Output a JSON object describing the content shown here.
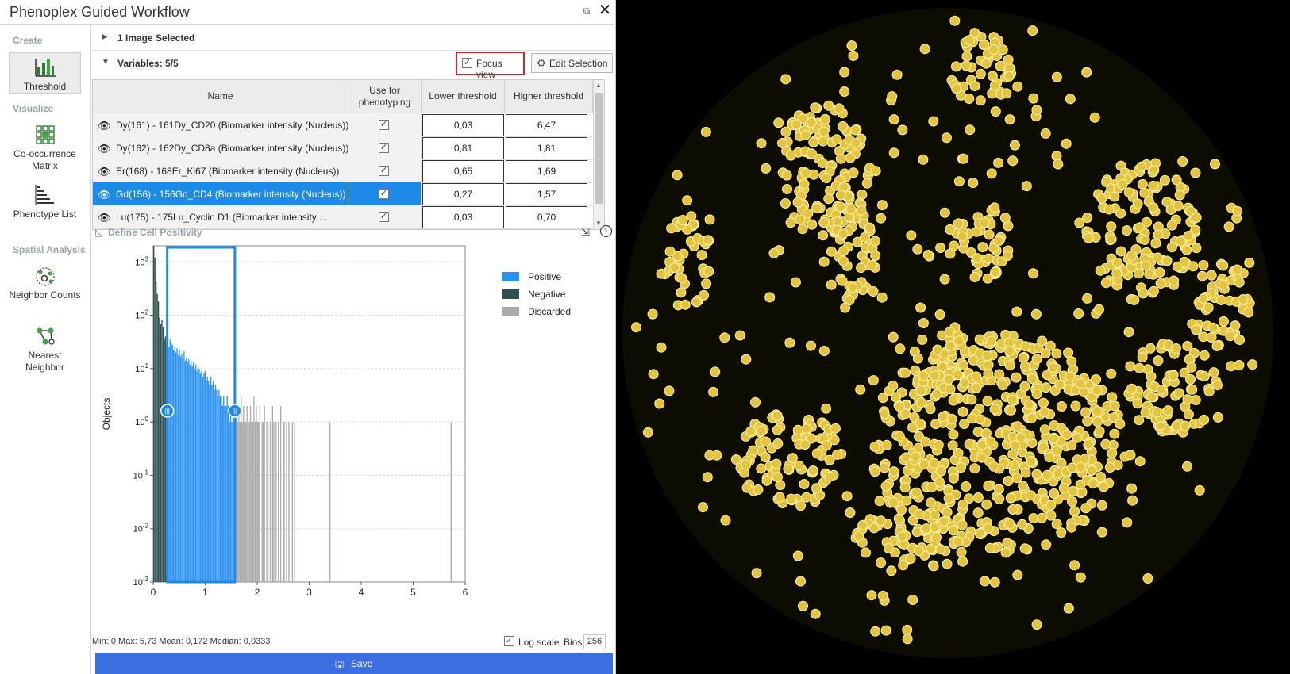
{
  "window": {
    "title": "Phenoplex Guided Workflow"
  },
  "sidebar": {
    "sections": [
      {
        "label": "Create"
      },
      {
        "label": "Visualize"
      },
      {
        "label": "Spatial Analysis"
      }
    ],
    "tools": [
      {
        "label": "Threshold",
        "icon": "threshold-icon",
        "active": true
      },
      {
        "label": "Co-occurrence Matrix",
        "icon": "cooccurrence-matrix-icon"
      },
      {
        "label": "Phenotype List",
        "icon": "phenotype-list-icon"
      },
      {
        "label": "Neighbor Counts",
        "icon": "neighbor-counts-icon"
      },
      {
        "label": "Nearest Neighbor",
        "icon": "nearest-neighbor-icon"
      }
    ]
  },
  "images_section": {
    "label": "1 Image Selected"
  },
  "variables_section": {
    "label": "Variables: 5/5",
    "focus_view_label": "Focus view",
    "focus_view_checked": true,
    "edit_selection_label": "Edit Selection"
  },
  "table": {
    "headers": {
      "name": "Name",
      "use": "Use for phenotyping",
      "lower": "Lower threshold",
      "higher": "Higher threshold"
    },
    "rows": [
      {
        "name": "Dy(161) - 161Dy_CD20 (Biomarker intensity (Nucleus))",
        "use": true,
        "lower": "0,03",
        "higher": "6,47",
        "selected": false
      },
      {
        "name": "Dy(162) - 162Dy_CD8a (Biomarker intensity (Nucleus))",
        "use": true,
        "lower": "0,81",
        "higher": "1,81",
        "selected": false
      },
      {
        "name": "Er(168) - 168Er_Ki67 (Biomarker intensity (Nucleus))",
        "use": true,
        "lower": "0,65",
        "higher": "1,69",
        "selected": false
      },
      {
        "name": "Gd(156) - 156Gd_CD4 (Biomarker intensity (Nucleus))",
        "use": true,
        "lower": "0,27",
        "higher": "1,57",
        "selected": true
      },
      {
        "name": "Lu(175) - 175Lu_Cyclin D1 (Biomarker intensity ...",
        "use": true,
        "lower": "0,03",
        "higher": "0,70",
        "selected": false
      }
    ]
  },
  "positivity": {
    "title": "Define Cell Positivity",
    "stats": "Min: 0   Max: 5,73   Mean: 0,172   Median: 0,0333",
    "log_scale_label": "Log scale",
    "log_scale_checked": true,
    "bins_label": "Bins",
    "bins_value": "256",
    "save_label": "Save"
  },
  "chart_data": {
    "type": "bar",
    "title": "",
    "xlabel": "",
    "ylabel": "Objects",
    "y_scale": "log",
    "xlim": [
      0,
      6
    ],
    "ylim": [
      0.001,
      2000
    ],
    "x_ticks": [
      "0",
      "1",
      "2",
      "3",
      "4",
      "5",
      "6"
    ],
    "y_ticks": [
      "10^3",
      "10^2",
      "10^1",
      "10^0",
      "10^-1",
      "10^-2",
      "10^-3"
    ],
    "threshold_lower": 0.27,
    "threshold_upper": 1.57,
    "legend": [
      {
        "name": "Positive",
        "color": "#2b91f0"
      },
      {
        "name": "Negative",
        "color": "#2f4f4f"
      },
      {
        "name": "Discarded",
        "color": "#a9a9a9"
      }
    ],
    "legend_position": "top-right",
    "grid": "horizontal dotted",
    "series": [
      {
        "name": "Negative",
        "x": [
          0.011,
          0.034,
          0.056,
          0.079,
          0.101,
          0.123,
          0.146,
          0.168,
          0.191,
          0.213,
          0.235,
          0.258
        ],
        "values": [
          2000,
          1200,
          420,
          250,
          180,
          90,
          70,
          80,
          60,
          35,
          40,
          30
        ]
      },
      {
        "name": "Positive",
        "x": [
          0.28,
          0.303,
          0.325,
          0.347,
          0.37,
          0.392,
          0.415,
          0.437,
          0.459,
          0.482,
          0.504,
          0.527,
          0.549,
          0.571,
          0.594,
          0.616,
          0.639,
          0.661,
          0.683,
          0.706,
          0.728,
          0.751,
          0.773,
          0.795,
          0.818,
          0.84,
          0.863,
          0.885,
          0.907,
          0.93,
          0.952,
          0.975,
          0.997,
          1.019,
          1.042,
          1.064,
          1.087,
          1.109,
          1.131,
          1.154,
          1.176,
          1.199,
          1.221,
          1.243,
          1.266,
          1.288,
          1.311,
          1.333,
          1.355,
          1.378,
          1.4,
          1.423,
          1.445,
          1.467,
          1.49,
          1.512,
          1.535,
          1.557
        ],
        "values": [
          40,
          25,
          35,
          30,
          28,
          22,
          26,
          20,
          24,
          18,
          22,
          17,
          19,
          15,
          21,
          14,
          16,
          13,
          15,
          12,
          14,
          11,
          13,
          10,
          12,
          9,
          11,
          10,
          8,
          9,
          7,
          8,
          9,
          6,
          7,
          6,
          5,
          7,
          5,
          6,
          4,
          5,
          4,
          3,
          4,
          3,
          3,
          2,
          3,
          2,
          2,
          3,
          2,
          1,
          2,
          1,
          2,
          1
        ]
      },
      {
        "name": "Discarded",
        "x": [
          1.58,
          1.602,
          1.625,
          1.647,
          1.669,
          1.692,
          1.714,
          1.737,
          1.759,
          1.781,
          1.804,
          1.826,
          1.849,
          1.871,
          1.893,
          1.916,
          1.938,
          1.961,
          1.983,
          2.005,
          2.028,
          2.05,
          2.095,
          2.117,
          2.14,
          2.185,
          2.207,
          2.252,
          2.296,
          2.319,
          2.364,
          2.408,
          2.453,
          2.498,
          2.52,
          2.565,
          2.61,
          2.677,
          2.721,
          3.4,
          5.73
        ],
        "values": [
          3,
          2,
          1,
          2,
          1,
          3,
          1,
          2,
          1,
          1,
          2,
          1,
          1,
          2,
          1,
          1,
          3,
          1,
          2,
          1,
          1,
          2,
          1,
          1,
          2,
          1,
          1,
          1,
          2,
          1,
          1,
          1,
          2,
          1,
          1,
          1,
          1,
          1,
          1,
          1,
          1
        ]
      }
    ]
  }
}
